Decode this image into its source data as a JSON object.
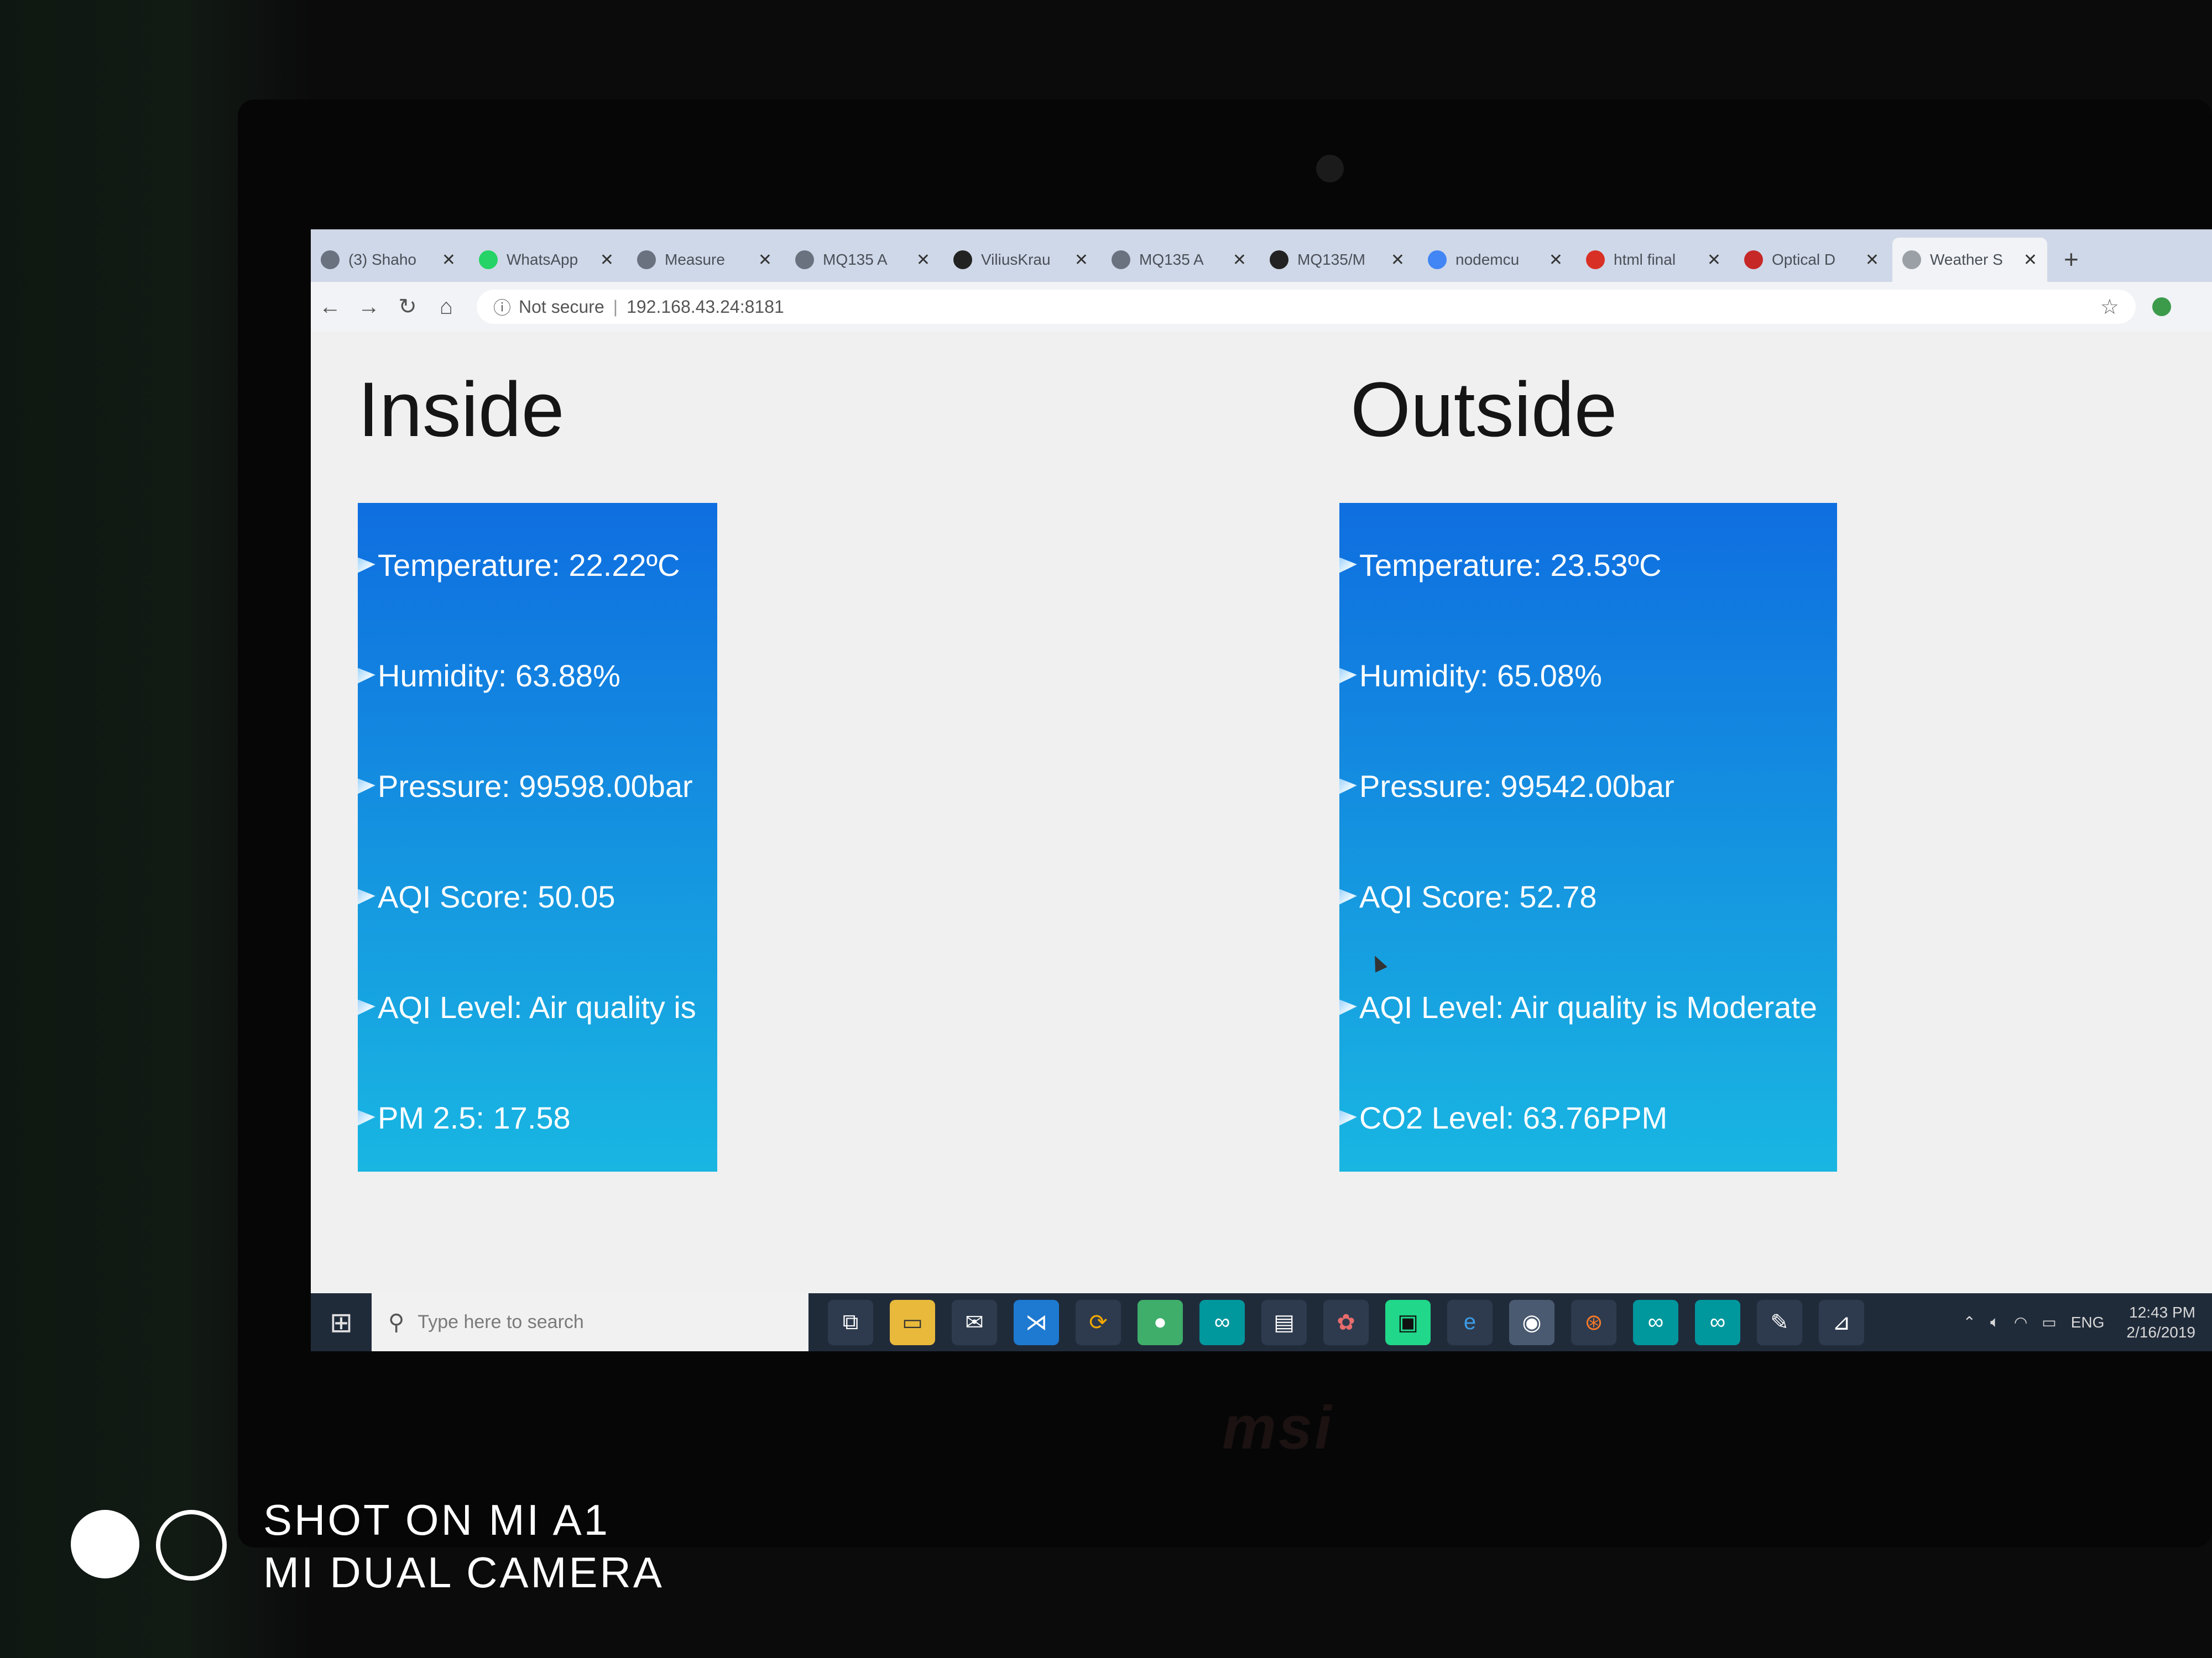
{
  "browser": {
    "tabs": [
      {
        "label": "(3) Shaho",
        "active": false
      },
      {
        "label": "WhatsApp",
        "active": false
      },
      {
        "label": "Measure",
        "active": false
      },
      {
        "label": "MQ135 A",
        "active": false
      },
      {
        "label": "ViliusKrau",
        "active": false
      },
      {
        "label": "MQ135 A",
        "active": false
      },
      {
        "label": "MQ135/M",
        "active": false
      },
      {
        "label": "nodemcu",
        "active": false
      },
      {
        "label": "html final",
        "active": false
      },
      {
        "label": "Optical D",
        "active": false
      },
      {
        "label": "Weather S",
        "active": true
      }
    ],
    "new_tab": "+",
    "security_label": "Not secure",
    "url": "192.168.43.24:8181"
  },
  "page": {
    "inside": {
      "title": "Inside",
      "items": [
        "Temperature: 22.22ºC",
        "Humidity: 63.88%",
        "Pressure: 99598.00bar",
        "AQI Score: 50.05",
        "AQI Level: Air quality is",
        "PM 2.5: 17.58"
      ]
    },
    "outside": {
      "title": "Outside",
      "items": [
        "Temperature: 23.53ºC",
        "Humidity: 65.08%",
        "Pressure: 99542.00bar",
        "AQI Score: 52.78",
        "AQI Level: Air quality is Moderate",
        "CO2 Level: 63.76PPM"
      ]
    }
  },
  "taskbar": {
    "search_placeholder": "Type here to search",
    "language": "ENG",
    "time": "12:43 PM",
    "date": "2/16/2019"
  },
  "laptop": {
    "brand": "msi"
  },
  "watermark": {
    "line1": "SHOT ON MI A1",
    "line2": "MI DUAL CAMERA"
  },
  "colors": {
    "panel_top": "#0f6ee0",
    "panel_bottom": "#19b6e2",
    "taskbar": "#202b3a"
  }
}
